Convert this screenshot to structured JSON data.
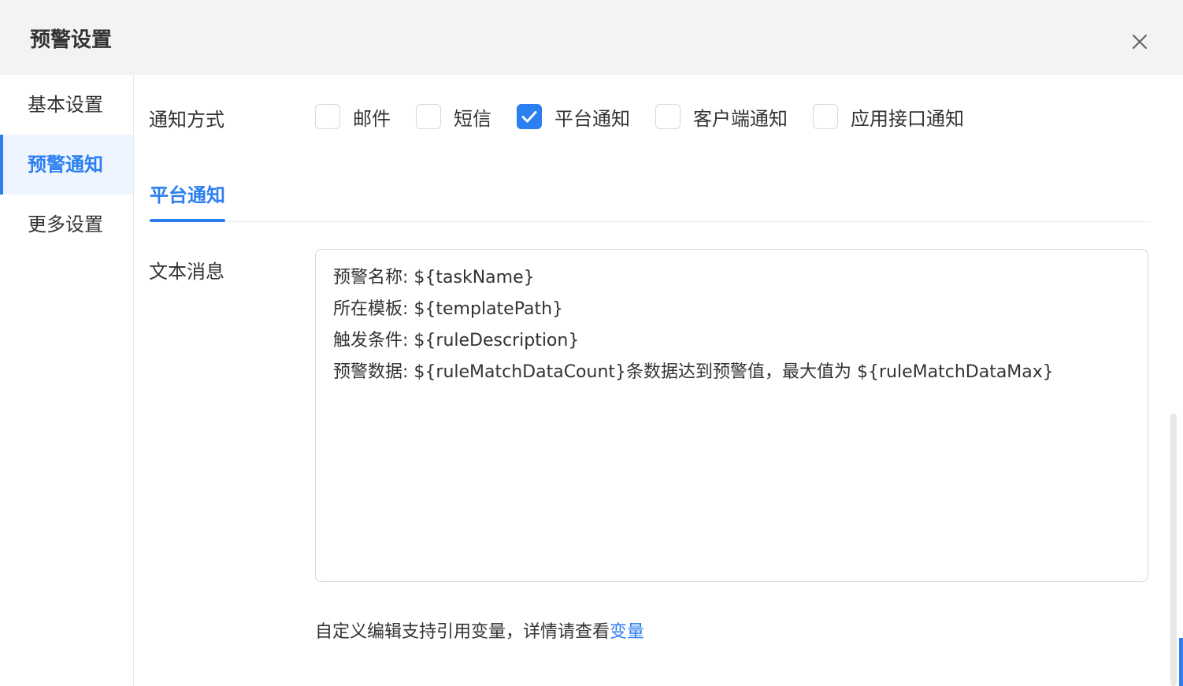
{
  "dialog": {
    "title": "预警设置"
  },
  "sidebar": {
    "items": [
      {
        "label": "基本设置"
      },
      {
        "label": "预警通知"
      },
      {
        "label": "更多设置"
      }
    ],
    "active_index": 1
  },
  "notify": {
    "label": "通知方式",
    "options": [
      {
        "label": "邮件",
        "checked": false
      },
      {
        "label": "短信",
        "checked": false
      },
      {
        "label": "平台通知",
        "checked": true
      },
      {
        "label": "客户端通知",
        "checked": false
      },
      {
        "label": "应用接口通知",
        "checked": false
      }
    ]
  },
  "tabs": [
    {
      "label": "平台通知"
    }
  ],
  "message": {
    "label": "文本消息",
    "lines": [
      "预警名称: ${taskName}",
      "所在模板: ${templatePath}",
      "触发条件: ${ruleDescription}",
      "预警数据: ${ruleMatchDataCount}条数据达到预警值，最大值为 ${ruleMatchDataMax}"
    ]
  },
  "hint": {
    "text": "自定义编辑支持引用变量，详情请查看",
    "link": "变量"
  },
  "colors": {
    "accent": "#2b7ff0",
    "header_bg": "#f2f3f5",
    "active_bg": "#eef5ff"
  }
}
